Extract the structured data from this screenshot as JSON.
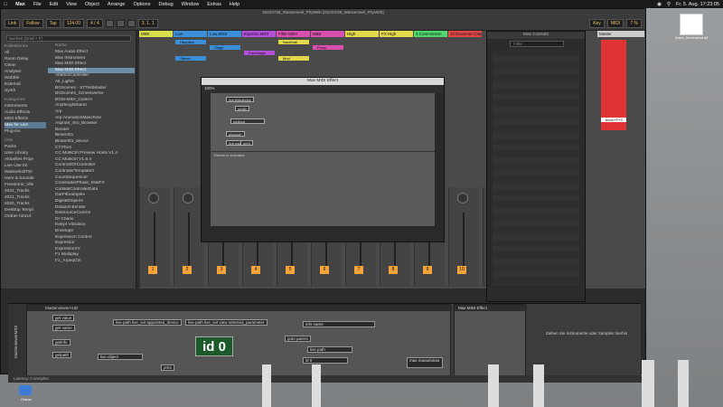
{
  "menubar": {
    "apple": "",
    "app": "Max",
    "items": [
      "File",
      "Edit",
      "View",
      "Object",
      "Arrange",
      "Options",
      "Debug",
      "Window",
      "Extras",
      "Help"
    ],
    "clock": "Fr. 5. Aug. 17:23:05"
  },
  "live": {
    "title": "20220728_Wasserseel_PhyWeb [20220728_Wasserseel_PhyWeb]",
    "transport": {
      "link": "Link",
      "follow": "Follow",
      "tap": "Tap",
      "tempo": "124.00",
      "sig": "4 / 4",
      "position": "3. 1. 1",
      "key": "Key",
      "midi": "MIDI",
      "cpu": "7 %"
    },
    "browser": {
      "search_placeholder": "Suchen (Cmd + F)",
      "collections": [
        "Kollektionen"
      ],
      "categories": [
        "All",
        "Room Delay",
        "Clean",
        "Analyser",
        "Wobble",
        "External",
        "Synth"
      ],
      "places_head": "Kategorien",
      "places": [
        "Instruments",
        "Audio Effects",
        "MIDI Effects",
        "Max for Live",
        "Plug-Ins"
      ],
      "orte_head": "Orte",
      "orte": [
        "Packs",
        "User Library",
        "Aktuelles Proje",
        "Live Use Kit",
        "WasserkollTEI",
        "Here & Sounds",
        "Freestone_Vile",
        "2022_Tracks",
        "2021_Tracks",
        "2020_Tracks",
        "Desktop Templ.",
        "Ordner hinzuf."
      ],
      "name_head": "Name",
      "items": [
        "Max Audio Effect",
        "Max Instrument",
        "Max MIDI Effect",
        "Max MIDI Effect",
        "AbletonController",
        "All_Lights",
        "BGScenes - STTestMaster",
        "BGScenes_Scheinwerfer",
        "BGM-MIDI_Control",
        "AnythingNStand",
        "Arp",
        "Arp-AnimationMaschine",
        "Asphalt_info_Browser",
        "Bender",
        "Binsert01",
        "Binsert03_device",
        "CT4Tool",
        "CC MultiCtrl Preview Hosts V1.4",
        "CC Multictrl V1.8.4",
        "ControlZOrController",
        "ControllerTemplate3",
        "CountSequencer",
        "CrossfaderPhase_MidiFX",
        "CutMidiControllerData",
        "DarFlExamples",
        "DigitalEmpires",
        "Distanzl Bender",
        "DistSourceControl",
        "Dr Chaos",
        "Easy4 Vibration",
        "Envelope",
        "Expression Control",
        "Expressor",
        "ExpressorXY",
        "F1 Multiplay",
        "F1_ArpeqCtrl"
      ],
      "selected_item": 3
    },
    "tracks": [
      {
        "name": "MIDI",
        "color": "#d8dd4a"
      },
      {
        "name": "Low",
        "color": "#3b8fd9"
      },
      {
        "name": "Low MIDI",
        "color": "#3b8fd9"
      },
      {
        "name": "Express MIDI",
        "color": "#b34fd8"
      },
      {
        "name": "Filter MIDI",
        "color": "#d84fb0"
      },
      {
        "name": "MIDI",
        "color": "#d84fb0"
      },
      {
        "name": "High",
        "color": "#e3d74a"
      },
      {
        "name": "FX High",
        "color": "#e3d74a"
      },
      {
        "name": "3 Commission",
        "color": "#4fd86b"
      },
      {
        "name": "10 Drummer Clapper",
        "color": "#e34646"
      }
    ],
    "clips": [
      "Hauptton",
      "HiHat",
      "MicroDelay",
      "Nachhall",
      "Filter+LFO",
      "Ceremonie",
      "Stage",
      "FreeStage",
      "Mod",
      "Pump",
      "Stereo"
    ],
    "mixer_numbers": [
      "1",
      "2",
      "3",
      "4",
      "5",
      "6",
      "7",
      "8",
      "9",
      "10",
      "11"
    ],
    "master": {
      "name": "Master",
      "clip": "block+F+C"
    },
    "status": "Latency: 0 samples"
  },
  "max_window": {
    "title": "Max MIDI Effect",
    "zoom": "100%",
    "objects": [
      "live.thisdevice",
      "midiin",
      "midiout",
      "plugout~",
      "live.path",
      "print"
    ],
    "presentation_label": "Device is activated"
  },
  "console": {
    "title": "Max Console",
    "filter_placeholder": "Filter"
  },
  "device": {
    "patch_title": "MasterviewerAUD",
    "side_label": "MasterviewerMIDI",
    "objects": {
      "get_value": "get value",
      "get_name": "get name",
      "getinfo": "getinfo",
      "getpath": "getpath",
      "live_object": "live.object",
      "print": "print",
      "path1": "live.path live_set appointed_device",
      "path2": "live.path live_set view selected_parameter",
      "goto": "goto parent",
      "info": "info name",
      "livepath": "live.path",
      "id0": "id 0",
      "maxwindow": "max maxwindow"
    },
    "big_id": "id 0",
    "max_device_title": "Max MIDI Effect",
    "drop_text": "Ziehen Sie Instrumente oder Samples hierhin"
  },
  "desktop": {
    "folder_label": "Ordner",
    "file_label": "Asset_Screenshot.aif"
  }
}
